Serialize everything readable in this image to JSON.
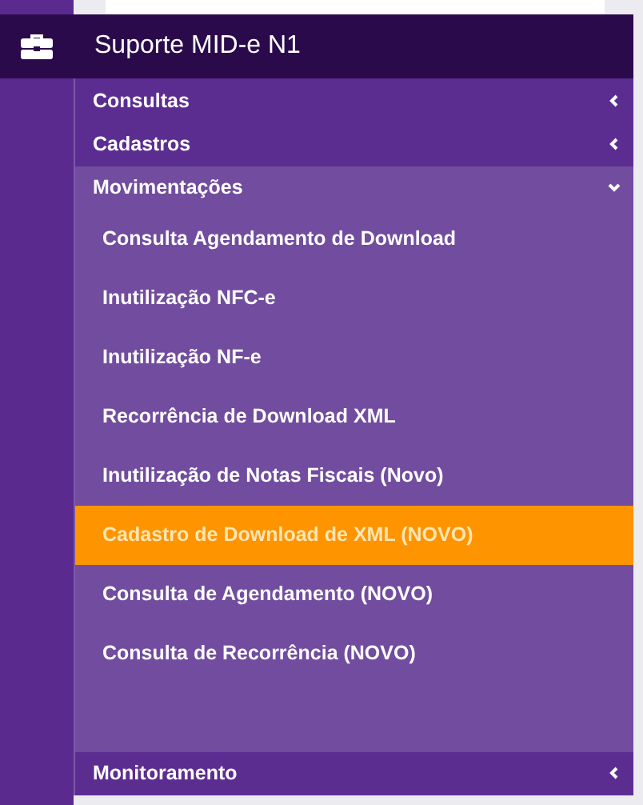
{
  "header": {
    "title": "Suporte MID-e N1"
  },
  "menu": [
    {
      "label": "Consultas",
      "expanded": false
    },
    {
      "label": "Cadastros",
      "expanded": false
    },
    {
      "label": "Movimentações",
      "expanded": true,
      "children": [
        {
          "label": "Consulta Agendamento de Download",
          "selected": false
        },
        {
          "label": "Inutilização NFC-e",
          "selected": false
        },
        {
          "label": "Inutilização NF-e",
          "selected": false
        },
        {
          "label": "Recorrência de Download XML",
          "selected": false
        },
        {
          "label": "Inutilização de Notas Fiscais (Novo)",
          "selected": false
        },
        {
          "label": "Cadastro de Download de XML (NOVO)",
          "selected": true
        },
        {
          "label": "Consulta de Agendamento (NOVO)",
          "selected": false
        },
        {
          "label": "Consulta de Recorrência (NOVO)",
          "selected": false
        }
      ]
    },
    {
      "label": "Monitoramento",
      "expanded": false
    }
  ]
}
